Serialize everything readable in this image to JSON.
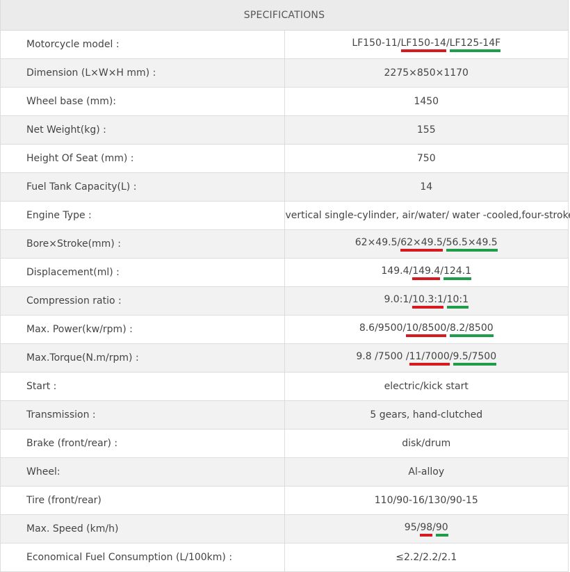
{
  "header": "SPECIFICATIONS",
  "colors": {
    "red_mark": "#d71920",
    "green_mark": "#1f9d4b"
  },
  "rows": [
    {
      "label": "Motorcycle model :",
      "value": [
        {
          "t": "LF150-11/"
        },
        {
          "t": "LF150-14",
          "m": "red"
        },
        {
          "t": "/"
        },
        {
          "t": "LF125-14F",
          "m": "green"
        }
      ]
    },
    {
      "label": "Dimension (L×W×H mm) :",
      "value": [
        {
          "t": "2275×850×1170"
        }
      ]
    },
    {
      "label": "Wheel base (mm):",
      "value": [
        {
          "t": "1450"
        }
      ]
    },
    {
      "label": "Net Weight(kg) :",
      "value": [
        {
          "t": "155"
        }
      ]
    },
    {
      "label": "Height Of Seat (mm) :",
      "value": [
        {
          "t": "750"
        }
      ]
    },
    {
      "label": "Fuel Tank Capacity(L) :",
      "value": [
        {
          "t": "14"
        }
      ]
    },
    {
      "label": "Engine Type :",
      "value": [
        {
          "t": "vertical single-cylinder, air/water/ water -cooled,four-stroke"
        }
      ]
    },
    {
      "label": "Bore×Stroke(mm) :",
      "value": [
        {
          "t": "62×49.5/"
        },
        {
          "t": "62×49.5",
          "m": "red"
        },
        {
          "t": "/"
        },
        {
          "t": "56.5×49.5",
          "m": "green"
        }
      ]
    },
    {
      "label": "Displacement(ml) :",
      "value": [
        {
          "t": "149.4/"
        },
        {
          "t": "149.4",
          "m": "red"
        },
        {
          "t": "/"
        },
        {
          "t": "124.1",
          "m": "green"
        }
      ]
    },
    {
      "label": "Compression ratio :",
      "value": [
        {
          "t": "9.0:1/"
        },
        {
          "t": "10.3:1",
          "m": "red"
        },
        {
          "t": "/"
        },
        {
          "t": "10:1",
          "m": "green"
        }
      ]
    },
    {
      "label": "Max. Power(kw/rpm) :",
      "value": [
        {
          "t": "8.6/9500/"
        },
        {
          "t": "10/8500",
          "m": "red"
        },
        {
          "t": " /"
        },
        {
          "t": "8.2/8500",
          "m": "green"
        }
      ]
    },
    {
      "label": "Max.Torque(N.m/rpm) :",
      "value": [
        {
          "t": "9.8 /7500 /"
        },
        {
          "t": "11/7000",
          "m": "red"
        },
        {
          "t": "/"
        },
        {
          "t": "9.5/7500",
          "m": "green"
        }
      ]
    },
    {
      "label": "Start :",
      "value": [
        {
          "t": "electric/kick start"
        }
      ]
    },
    {
      "label": "Transmission :",
      "value": [
        {
          "t": "5 gears, hand-clutched"
        }
      ]
    },
    {
      "label": "Brake (front/rear) :",
      "value": [
        {
          "t": "disk/drum"
        }
      ]
    },
    {
      "label": "Wheel:",
      "value": [
        {
          "t": "Al-alloy"
        }
      ]
    },
    {
      "label": "Tire (front/rear)",
      "value": [
        {
          "t": "110/90-16/130/90-15"
        }
      ]
    },
    {
      "label": "Max. Speed (km/h)",
      "value": [
        {
          "t": "95/"
        },
        {
          "t": "98",
          "m": "red"
        },
        {
          "t": "/"
        },
        {
          "t": "90",
          "m": "green"
        }
      ]
    },
    {
      "label": "Economical Fuel Consumption (L/100km) :",
      "value": [
        {
          "t": "≤2.2/2.2/2.1"
        }
      ]
    }
  ]
}
